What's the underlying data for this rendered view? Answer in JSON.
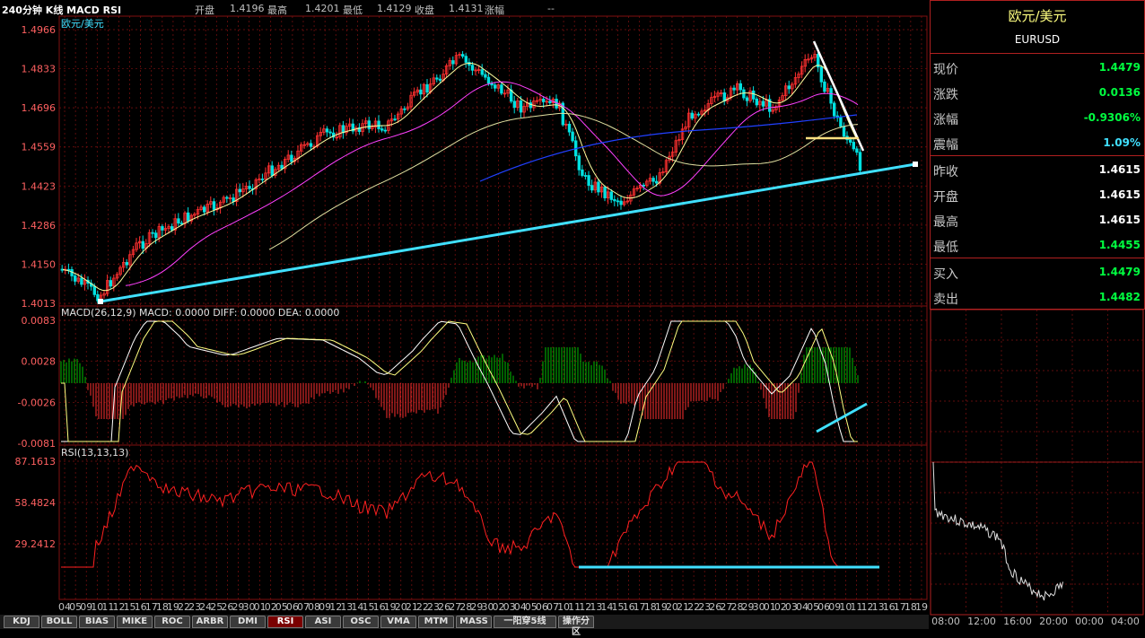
{
  "header": {
    "title": "240分钟 K线 MACD RSI",
    "open_label": "开盘",
    "open_value": "1.4196",
    "high_label": "最高",
    "high_value": "1.4201",
    "low_label": "最低",
    "low_value": "1.4129",
    "close_label": "收盘",
    "close_value": "1.4131",
    "change_label": "涨幅",
    "change_value": "--"
  },
  "main_panel": {
    "series_label": "欧元/美元",
    "y_ticks": [
      "1.4966",
      "1.4833",
      "1.4696",
      "1.4559",
      "1.4423",
      "1.4286",
      "1.4150",
      "1.4013"
    ]
  },
  "macd_panel": {
    "header": "MACD(26,12,9)  MACD: 0.0000  DIFF: 0.0000  DEA: 0.0000",
    "y_ticks": [
      "0.0083",
      "0.0028",
      "-0.0026",
      "-0.0081"
    ]
  },
  "rsi_panel": {
    "header": "RSI(13,13,13)",
    "y_ticks": [
      "87.1613",
      "58.4824",
      "29.2412"
    ]
  },
  "x_axis": {
    "labels": [
      "04",
      "05",
      "09",
      "10",
      "11",
      "12",
      "15",
      "16",
      "17",
      "18",
      "19",
      "22",
      "23",
      "24",
      "25",
      "26",
      "29",
      "30",
      "01",
      "02",
      "05",
      "06",
      "07",
      "08",
      "09",
      "12",
      "13",
      "14",
      "15",
      "16",
      "19",
      "20",
      "21",
      "22",
      "23",
      "26",
      "27",
      "28",
      "29",
      "30",
      "02",
      "03",
      "04",
      "05",
      "06",
      "07",
      "10",
      "11",
      "12",
      "13",
      "14",
      "15",
      "16",
      "17",
      "18",
      "19",
      "20",
      "21",
      "22",
      "23",
      "26",
      "27",
      "28",
      "29",
      "30",
      "01",
      "02",
      "03",
      "04",
      "05",
      "06",
      "09",
      "10",
      "11",
      "12",
      "13",
      "16",
      "17",
      "18",
      "19"
    ]
  },
  "tabs": [
    "KDJ",
    "BOLL",
    "BIAS",
    "MIKE",
    "ROC",
    "ARBR",
    "DMI",
    "RSI",
    "ASI",
    "OSC",
    "VMA",
    "MTM",
    "MASS",
    "一阳穿5线",
    "操作分区"
  ],
  "active_tab": "RSI",
  "info": {
    "name": "欧元/美元",
    "code": "EURUSD",
    "rows": [
      {
        "label": "现价",
        "value": "1.4479",
        "color": "#00ff40"
      },
      {
        "label": "涨跌",
        "value": "0.0136",
        "color": "#00ff40"
      },
      {
        "label": "涨幅",
        "value": "-0.9306%",
        "color": "#00ff40"
      },
      {
        "label": "震幅",
        "value": "1.09%",
        "color": "#40e0ff"
      },
      {
        "label": "昨收",
        "value": "1.4615",
        "color": "#ffffff"
      },
      {
        "label": "开盘",
        "value": "1.4615",
        "color": "#ffffff"
      },
      {
        "label": "最高",
        "value": "1.4615",
        "color": "#ffffff"
      },
      {
        "label": "最低",
        "value": "1.4455",
        "color": "#00ff40"
      },
      {
        "label": "买入",
        "value": "1.4479",
        "color": "#00ff40"
      },
      {
        "label": "卖出",
        "value": "1.4482",
        "color": "#00ff40"
      }
    ]
  },
  "mini_chart": {
    "x_labels": [
      "08:00",
      "12:00",
      "16:00",
      "20:00",
      "00:00",
      "04:00"
    ]
  },
  "colors": {
    "up": "#ff3030",
    "down": "#00e0e0",
    "macd_neg": "#00c000",
    "rsi": "#ff2020",
    "trend_cyan": "#40e0ff",
    "grid": "#801010",
    "accent_label": "#ffff80"
  }
}
